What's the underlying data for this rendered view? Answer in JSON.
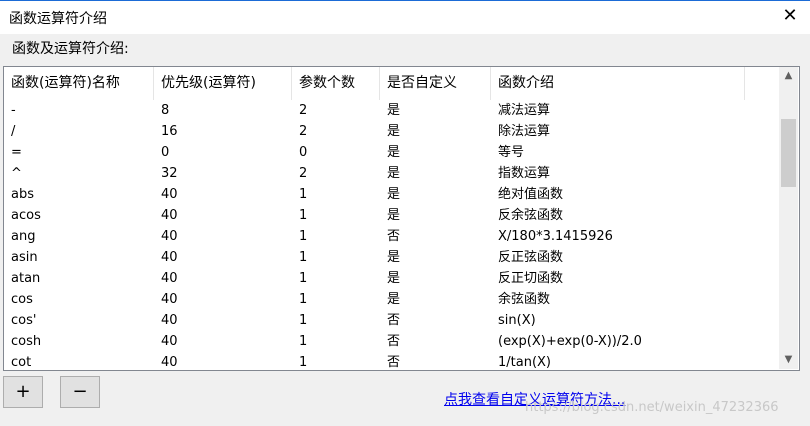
{
  "window": {
    "title": "函数运算符介绍"
  },
  "section_label": "函数及运算符介绍:",
  "table": {
    "columns": [
      "函数(运算符)名称",
      "优先级(运算符)",
      "参数个数",
      "是否自定义",
      "函数介绍"
    ],
    "rows": [
      [
        "-",
        "8",
        "2",
        "是",
        "减法运算"
      ],
      [
        "/",
        "16",
        "2",
        "是",
        "除法运算"
      ],
      [
        "=",
        "0",
        "0",
        "是",
        "等号"
      ],
      [
        "^",
        "32",
        "2",
        "是",
        "指数运算"
      ],
      [
        "abs",
        "40",
        "1",
        "是",
        "绝对值函数"
      ],
      [
        "acos",
        "40",
        "1",
        "是",
        "反余弦函数"
      ],
      [
        "ang",
        "40",
        "1",
        "否",
        "X/180*3.1415926"
      ],
      [
        "asin",
        "40",
        "1",
        "是",
        "反正弦函数"
      ],
      [
        "atan",
        "40",
        "1",
        "是",
        "反正切函数"
      ],
      [
        "cos",
        "40",
        "1",
        "是",
        "余弦函数"
      ],
      [
        "cos'",
        "40",
        "1",
        "否",
        "sin(X)"
      ],
      [
        "cosh",
        "40",
        "1",
        "否",
        "(exp(X)+exp(0-X))/2.0"
      ],
      [
        "cot",
        "40",
        "1",
        "否",
        "1/tan(X)"
      ]
    ]
  },
  "buttons": {
    "add": "+",
    "remove": "−"
  },
  "link": "点我查看自定义运算符方法...",
  "watermark": "https://blog.csdn.net/weixin_47232366"
}
